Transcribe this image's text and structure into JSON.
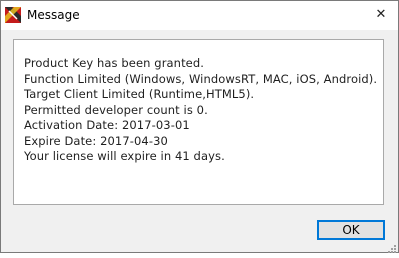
{
  "window": {
    "title": "Message",
    "close_glyph": "✕"
  },
  "message": {
    "line1": "Product Key has been granted.",
    "line2": "Function Limited (Windows, WindowsRT, MAC, iOS, Android).",
    "line3": "Target Client Limited (Runtime,HTML5).",
    "line4": "Permitted developer count is 0.",
    "line5": "Activation Date: 2017-03-01",
    "line6": "Expire Date: 2017-04-30",
    "line7": "Your license will expire in 41 days."
  },
  "buttons": {
    "ok_label": "OK"
  },
  "icons": {
    "app": "app-logo-icon",
    "close": "close-icon",
    "grip": "resize-grip-icon"
  },
  "colors": {
    "focus_border": "#0078d7",
    "logo_red": "#c41b1b",
    "logo_dark": "#2b2b2b"
  }
}
